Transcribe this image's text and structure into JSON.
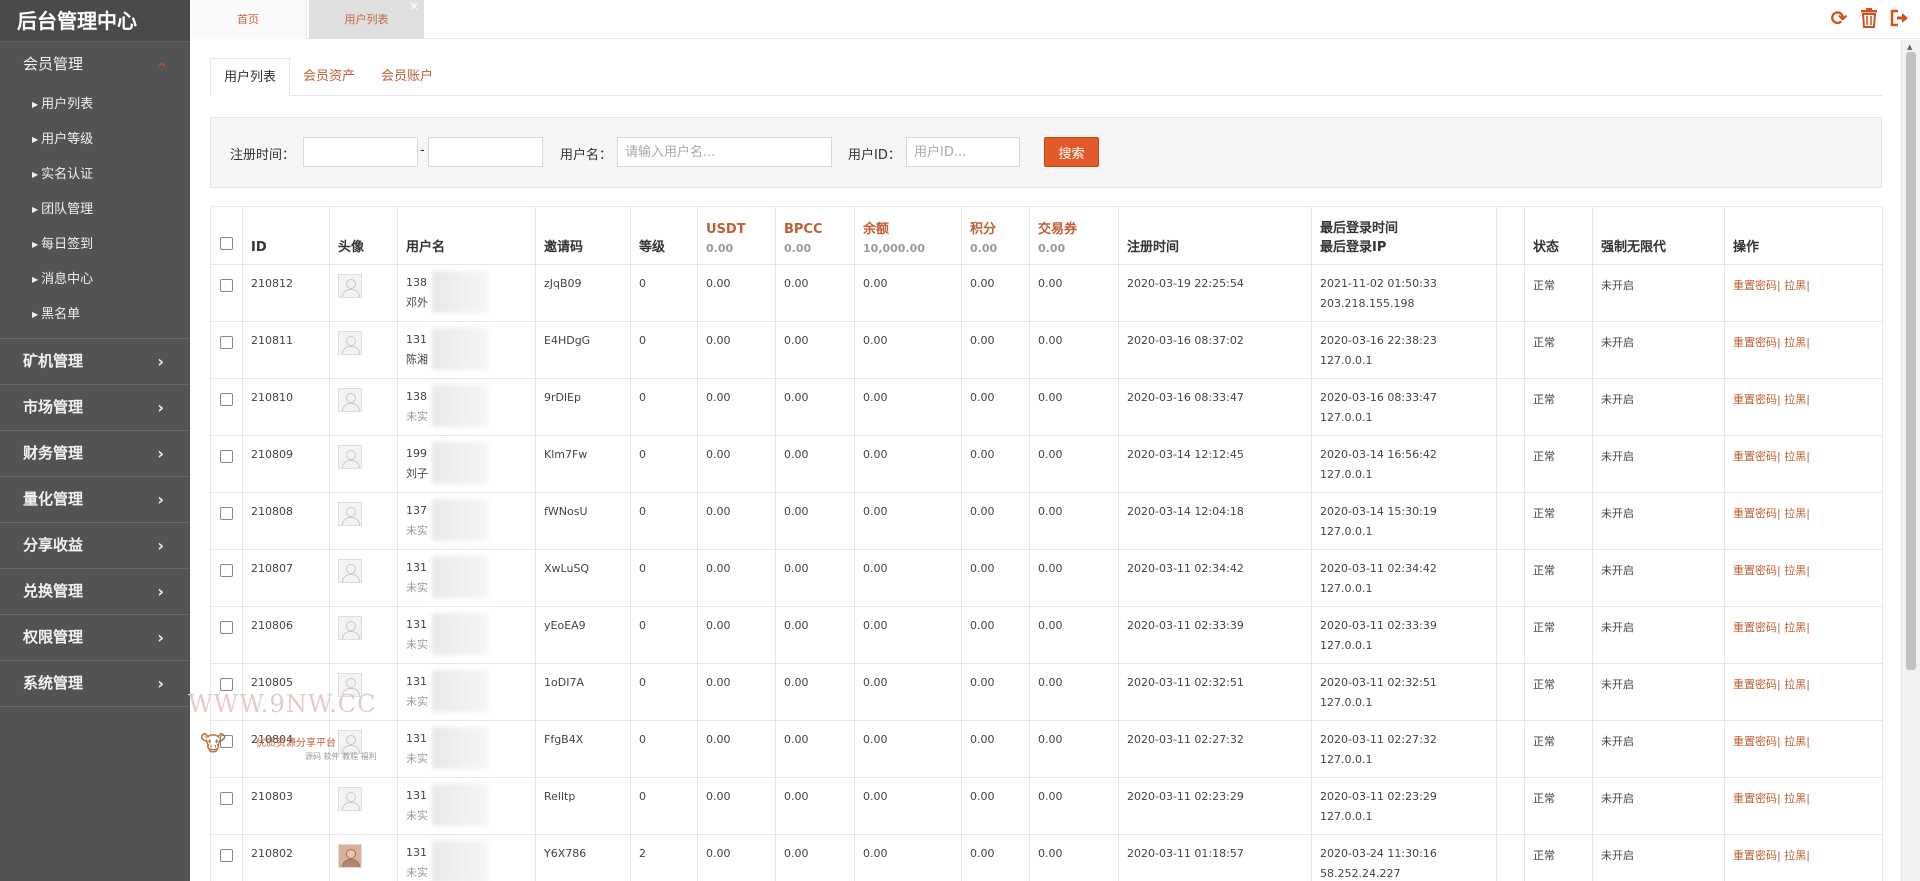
{
  "app_title": "后台管理中心",
  "sidebar": {
    "groups": [
      {
        "label": "会员管理",
        "expanded": true,
        "items": [
          "用户列表",
          "用户等级",
          "实名认证",
          "团队管理",
          "每日签到",
          "消息中心",
          "黑名单"
        ]
      },
      {
        "label": "矿机管理"
      },
      {
        "label": "市场管理"
      },
      {
        "label": "财务管理"
      },
      {
        "label": "量化管理"
      },
      {
        "label": "分享收益"
      },
      {
        "label": "兑换管理"
      },
      {
        "label": "权限管理"
      },
      {
        "label": "系统管理"
      }
    ]
  },
  "page_tabs": {
    "home": "首页",
    "users": "用户列表",
    "close": "×"
  },
  "toolbar_icons": [
    "refresh-icon",
    "trash-icon",
    "logout-icon"
  ],
  "content_tabs": [
    "用户列表",
    "会员资产",
    "会员账户"
  ],
  "filter": {
    "reg_time_label": "注册时间：",
    "dash": "-",
    "username_label": "用户名：",
    "username_placeholder": "请输入用户名...",
    "userid_label": "用户ID：",
    "userid_placeholder": "用户ID...",
    "search_button": "搜索"
  },
  "table": {
    "headers": {
      "id": "ID",
      "avatar": "头像",
      "username": "用户名",
      "invite": "邀请码",
      "level": "等级",
      "usdt": "USDT",
      "bpcc": "BPCC",
      "balance": "余额",
      "points": "积分",
      "voucher": "交易券",
      "reg_time": "注册时间",
      "last_login": "最后登录时间",
      "last_ip": "最后登录IP",
      "status": "状态",
      "unlimited": "强制无限代",
      "ops": "操作"
    },
    "sums": {
      "usdt": "0.00",
      "bpcc": "0.00",
      "balance": "10,000.00",
      "points": "0.00",
      "voucher": "0.00"
    },
    "ops_label": "重置密码| 拉黑|",
    "rows": [
      {
        "id": "210812",
        "user": "138",
        "sub": "邓外",
        "sub_real": true,
        "invite": "zJqB09",
        "level": "0",
        "usdt": "0.00",
        "bpcc": "0.00",
        "balance": "0.00",
        "points": "0.00",
        "voucher": "0.00",
        "reg": "2020-03-19 22:25:54",
        "login": "2021-11-02 01:50:33",
        "ip": "203.218.155.198",
        "status": "正常",
        "unlimited": "未开启",
        "photo": false
      },
      {
        "id": "210811",
        "user": "131",
        "sub": "陈湘",
        "sub_real": true,
        "invite": "E4HDgG",
        "level": "0",
        "usdt": "0.00",
        "bpcc": "0.00",
        "balance": "0.00",
        "points": "0.00",
        "voucher": "0.00",
        "reg": "2020-03-16 08:37:02",
        "login": "2020-03-16 22:38:23",
        "ip": "127.0.0.1",
        "status": "正常",
        "unlimited": "未开启",
        "photo": false
      },
      {
        "id": "210810",
        "user": "138",
        "sub": "未实",
        "sub_real": false,
        "invite": "9rDlEp",
        "level": "0",
        "usdt": "0.00",
        "bpcc": "0.00",
        "balance": "0.00",
        "points": "0.00",
        "voucher": "0.00",
        "reg": "2020-03-16 08:33:47",
        "login": "2020-03-16 08:33:47",
        "ip": "127.0.0.1",
        "status": "正常",
        "unlimited": "未开启",
        "photo": false
      },
      {
        "id": "210809",
        "user": "199",
        "sub": "刘子",
        "sub_real": true,
        "invite": "Klm7Fw",
        "level": "0",
        "usdt": "0.00",
        "bpcc": "0.00",
        "balance": "0.00",
        "points": "0.00",
        "voucher": "0.00",
        "reg": "2020-03-14 12:12:45",
        "login": "2020-03-14 16:56:42",
        "ip": "127.0.0.1",
        "status": "正常",
        "unlimited": "未开启",
        "photo": false
      },
      {
        "id": "210808",
        "user": "137",
        "sub": "未实",
        "sub_real": false,
        "invite": "fWNosU",
        "level": "0",
        "usdt": "0.00",
        "bpcc": "0.00",
        "balance": "0.00",
        "points": "0.00",
        "voucher": "0.00",
        "reg": "2020-03-14 12:04:18",
        "login": "2020-03-14 15:30:19",
        "ip": "127.0.0.1",
        "status": "正常",
        "unlimited": "未开启",
        "photo": false
      },
      {
        "id": "210807",
        "user": "131",
        "sub": "未实",
        "sub_real": false,
        "invite": "XwLuSQ",
        "level": "0",
        "usdt": "0.00",
        "bpcc": "0.00",
        "balance": "0.00",
        "points": "0.00",
        "voucher": "0.00",
        "reg": "2020-03-11 02:34:42",
        "login": "2020-03-11 02:34:42",
        "ip": "127.0.0.1",
        "status": "正常",
        "unlimited": "未开启",
        "photo": false
      },
      {
        "id": "210806",
        "user": "131",
        "sub": "未实",
        "sub_real": false,
        "invite": "yEoEA9",
        "level": "0",
        "usdt": "0.00",
        "bpcc": "0.00",
        "balance": "0.00",
        "points": "0.00",
        "voucher": "0.00",
        "reg": "2020-03-11 02:33:39",
        "login": "2020-03-11 02:33:39",
        "ip": "127.0.0.1",
        "status": "正常",
        "unlimited": "未开启",
        "photo": false
      },
      {
        "id": "210805",
        "user": "131",
        "sub": "未实",
        "sub_real": false,
        "invite": "1oDI7A",
        "level": "0",
        "usdt": "0.00",
        "bpcc": "0.00",
        "balance": "0.00",
        "points": "0.00",
        "voucher": "0.00",
        "reg": "2020-03-11 02:32:51",
        "login": "2020-03-11 02:32:51",
        "ip": "127.0.0.1",
        "status": "正常",
        "unlimited": "未开启",
        "photo": false
      },
      {
        "id": "210804",
        "user": "131",
        "sub": "未实",
        "sub_real": false,
        "invite": "FfgB4X",
        "level": "0",
        "usdt": "0.00",
        "bpcc": "0.00",
        "balance": "0.00",
        "points": "0.00",
        "voucher": "0.00",
        "reg": "2020-03-11 02:27:32",
        "login": "2020-03-11 02:27:32",
        "ip": "127.0.0.1",
        "status": "正常",
        "unlimited": "未开启",
        "photo": false
      },
      {
        "id": "210803",
        "user": "131",
        "sub": "未实",
        "sub_real": false,
        "invite": "Relltp",
        "level": "0",
        "usdt": "0.00",
        "bpcc": "0.00",
        "balance": "0.00",
        "points": "0.00",
        "voucher": "0.00",
        "reg": "2020-03-11 02:23:29",
        "login": "2020-03-11 02:23:29",
        "ip": "127.0.0.1",
        "status": "正常",
        "unlimited": "未开启",
        "photo": false
      },
      {
        "id": "210802",
        "user": "131",
        "sub": "未实",
        "sub_real": false,
        "invite": "Y6X786",
        "level": "2",
        "usdt": "0.00",
        "bpcc": "0.00",
        "balance": "0.00",
        "points": "0.00",
        "voucher": "0.00",
        "reg": "2020-03-11 01:18:57",
        "login": "2020-03-24 11:30:16",
        "ip": "58.252.24.227",
        "status": "正常",
        "unlimited": "未开启",
        "photo": true
      }
    ]
  },
  "watermark": {
    "url": "WWW.9NW.CC",
    "slogan": "优质资源分享平台",
    "tags": "源码 软件 教程 福利"
  }
}
